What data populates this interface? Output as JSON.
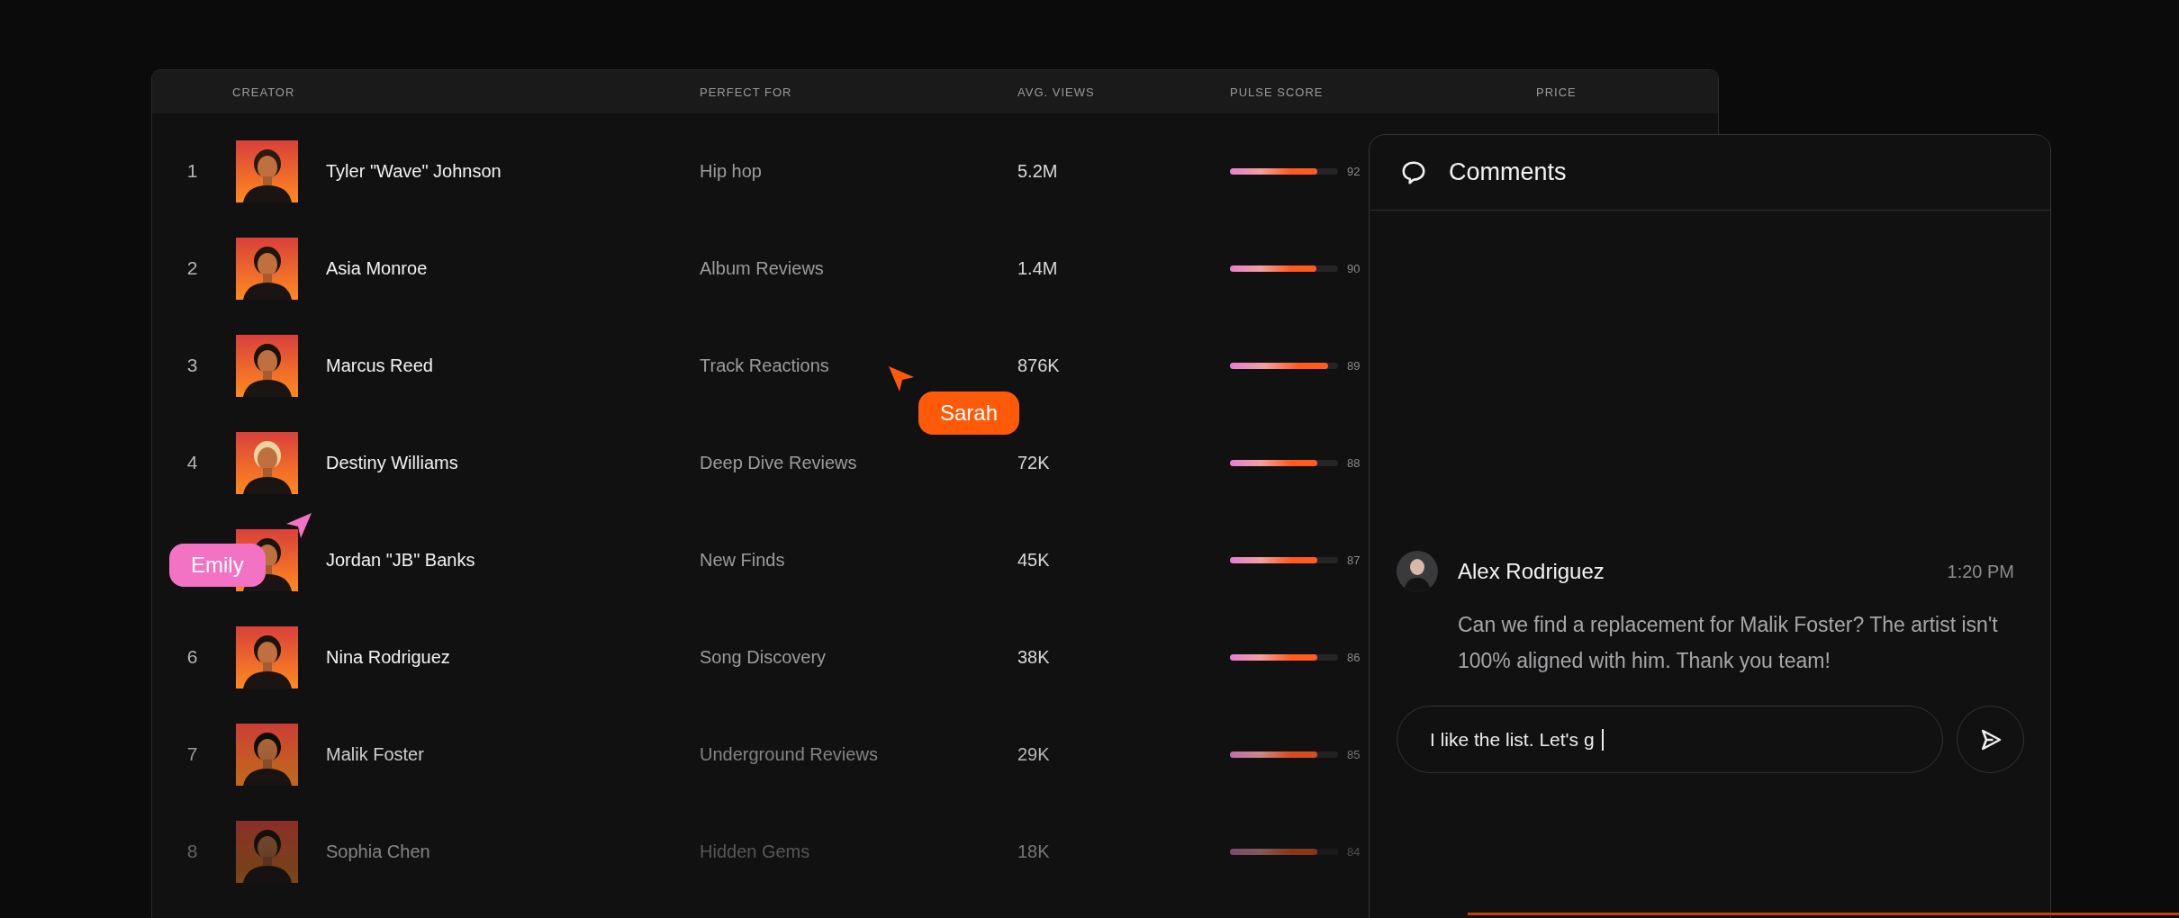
{
  "table": {
    "columns": [
      "CREATOR",
      "PERFECT FOR",
      "AVG. VIEWS",
      "PULSE SCORE",
      "PRICE"
    ],
    "rows": [
      {
        "rank": "1",
        "name": "Tyler \"Wave\" Johnson",
        "perfect_for": "Hip hop",
        "avg_views": "5.2M",
        "pulse_score": {
          "level": 0.81,
          "reading": "92"
        }
      },
      {
        "rank": "2",
        "name": "Asia Monroe",
        "perfect_for": "Album Reviews",
        "avg_views": "1.4M",
        "pulse_score": {
          "level": 0.8,
          "reading": "90"
        }
      },
      {
        "rank": "3",
        "name": "Marcus Reed",
        "perfect_for": "Track Reactions",
        "avg_views": "876K",
        "pulse_score": {
          "level": 0.91,
          "reading": "89"
        }
      },
      {
        "rank": "4",
        "name": "Destiny Williams",
        "perfect_for": "Deep Dive Reviews",
        "avg_views": "72K",
        "pulse_score": {
          "level": 0.81,
          "reading": "88"
        }
      },
      {
        "name": "Jordan \"JB\" Banks",
        "perfect_for": "New Finds",
        "avg_views": "45K",
        "pulse_score": {
          "level": 0.81,
          "reading": "87"
        }
      },
      {
        "rank": "6",
        "name": "Nina Rodriguez",
        "perfect_for": "Song Discovery",
        "avg_views": "38K",
        "pulse_score": {
          "level": 0.81,
          "reading": "86"
        }
      },
      {
        "rank": "7",
        "name": "Malik Foster",
        "perfect_for": "Underground Reviews",
        "avg_views": "29K",
        "pulse_score": {
          "level": 0.81,
          "reading": "85"
        }
      },
      {
        "rank": "8",
        "name": "Sophia Chen",
        "perfect_for": "Hidden Gems",
        "avg_views": "18K",
        "pulse_score": {
          "level": 0.81,
          "reading": "84"
        }
      }
    ]
  },
  "comments_panel": {
    "title": "Comments",
    "comments": [
      {
        "author": "Alex Rodriguez",
        "time": "1:20 PM",
        "text": "Can we find a replacement for Malik Foster? The artist isn't 100% aligned with him. Thank you team!"
      }
    ],
    "input": {
      "value": "I like the list. Let's g"
    }
  },
  "cursors": [
    {
      "name": "Sarah",
      "color": "#ff5a0a",
      "kind": "right"
    },
    {
      "name": "Emily",
      "color": "#f472c4",
      "kind": "left"
    }
  ]
}
